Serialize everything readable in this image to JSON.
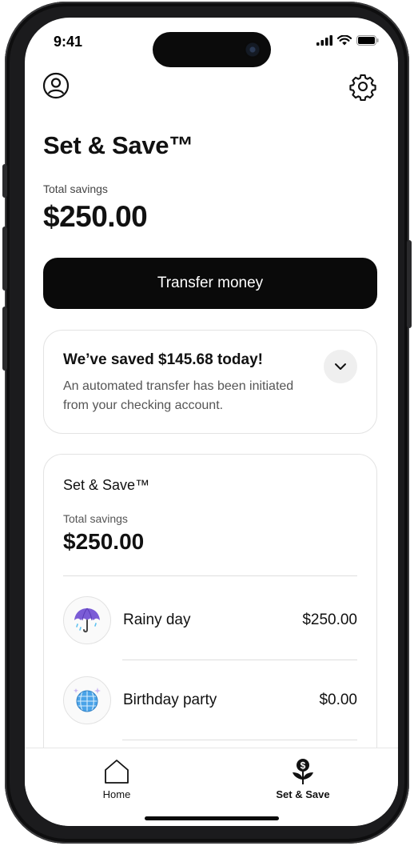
{
  "status_bar": {
    "time": "9:41"
  },
  "header": {
    "title": "Set & Save™"
  },
  "summary": {
    "label": "Total savings",
    "amount": "$250.00"
  },
  "transfer_button": {
    "label": "Transfer money"
  },
  "notice": {
    "title": "We’ve saved $145.68 today!",
    "body": "An automated transfer has been initiated from your checking account."
  },
  "savings_card": {
    "title": "Set & Save™",
    "label": "Total savings",
    "amount": "$250.00",
    "goals": [
      {
        "name": "Rainy day",
        "amount": "$250.00",
        "icon": "umbrella-icon"
      },
      {
        "name": "Birthday party",
        "amount": "$0.00",
        "icon": "disco-ball-icon"
      }
    ]
  },
  "tabbar": {
    "tabs": [
      {
        "label": "Home",
        "icon": "home-icon",
        "active": false
      },
      {
        "label": "Set & Save",
        "icon": "money-plant-icon",
        "active": true
      }
    ]
  },
  "colors": {
    "primary": "#0a0a0a",
    "card_border": "#e3e3e3",
    "chevron_bg": "#efefef",
    "umbrella": "#7b5cd6",
    "disco": "#4aa3e8"
  }
}
